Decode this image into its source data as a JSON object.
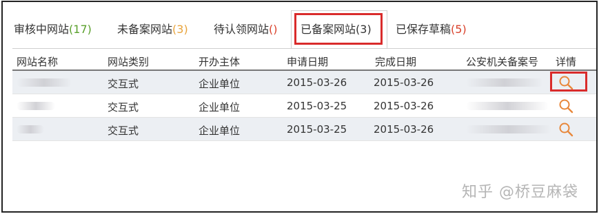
{
  "tabs": [
    {
      "label": "审核中网站",
      "count": "(17)",
      "color": "#5aa02c"
    },
    {
      "label": "未备案网站",
      "count": "(3)",
      "color": "#e8a33a"
    },
    {
      "label": "待认领网站",
      "count": "()",
      "color": "#d9412b"
    },
    {
      "label": "已备案网站",
      "count": "(3)",
      "color": "#333333"
    },
    {
      "label": "已保存草稿",
      "count": "(5)",
      "color": "#d9412b"
    }
  ],
  "active_tab": "已备案网站",
  "table": {
    "headers": {
      "name": "网站名称",
      "type": "网站类别",
      "subject": "开办主体",
      "apply_date": "申请日期",
      "complete_date": "完成日期",
      "police_no": "公安机关备案号",
      "detail": "详情"
    },
    "rows": [
      {
        "name": "",
        "type": "交互式",
        "subject": "企业单位",
        "apply_date": "2015-03-26",
        "complete_date": "2015-03-26",
        "police_no": ""
      },
      {
        "name": "",
        "type": "交互式",
        "subject": "企业单位",
        "apply_date": "2015-03-25",
        "complete_date": "2015-03-26",
        "police_no": ""
      },
      {
        "name": "",
        "type": "交互式",
        "subject": "企业单位",
        "apply_date": "2015-03-25",
        "complete_date": "2015-03-26",
        "police_no": ""
      }
    ]
  },
  "icons": {
    "detail": "search-icon"
  },
  "colors": {
    "highlight": "#d92b2b",
    "icon": "#e8873a"
  },
  "watermark": "知乎 @桥豆麻袋"
}
